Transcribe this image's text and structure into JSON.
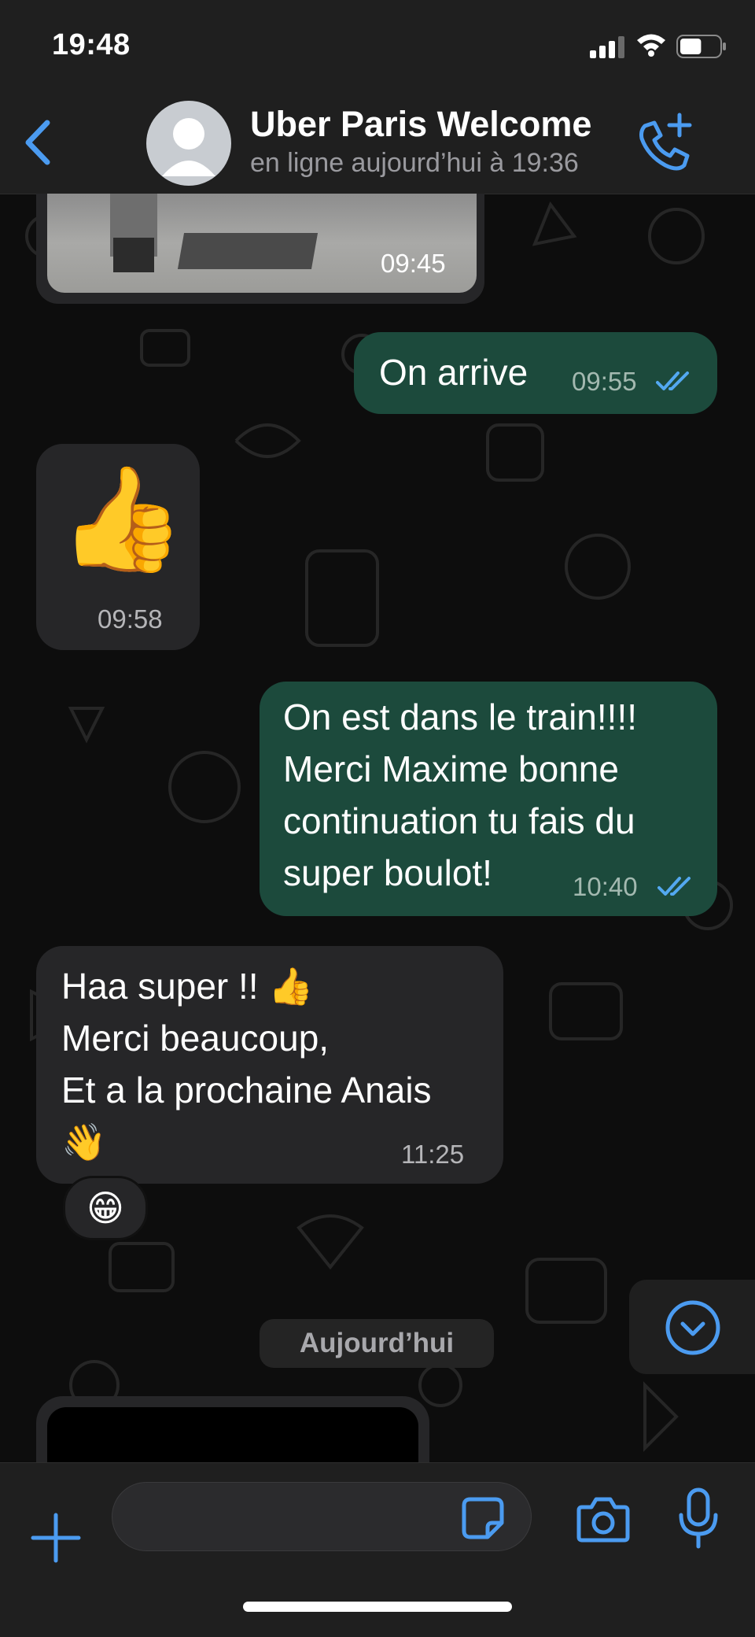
{
  "status_bar": {
    "time": "19:48",
    "battery_level": 0.55
  },
  "header": {
    "contact_name": "Uber Paris Welcome",
    "contact_status": "en ligne aujourd’hui à 19:36"
  },
  "messages": [
    {
      "type": "image",
      "direction": "in",
      "time": "09:45"
    },
    {
      "type": "text",
      "direction": "out",
      "lines": [
        "On arrive"
      ],
      "time": "09:55",
      "read": true
    },
    {
      "type": "emoji",
      "direction": "in",
      "emoji": "👍",
      "time": "09:58"
    },
    {
      "type": "text",
      "direction": "out",
      "lines": [
        "On est dans le train!!!!",
        "Merci Maxime bonne",
        "continuation tu fais du",
        "super boulot!"
      ],
      "time": "10:40",
      "read": true
    },
    {
      "type": "text",
      "direction": "in",
      "lines": [
        "Haa super !! 👍",
        "Merci beaucoup,",
        "Et a la prochaine Anais",
        "👋"
      ],
      "time": "11:25",
      "reaction": "😁"
    }
  ],
  "date_separator": "Aujourd’hui",
  "composer": {
    "value": "",
    "placeholder": ""
  },
  "colors": {
    "accent": "#4b9bf0",
    "outgoing_bubble": "#1c4a3c",
    "incoming_bubble": "#262628",
    "read_receipt": "#53a8f0"
  },
  "icons": [
    "back-chevron-icon",
    "avatar-placeholder-icon",
    "add-call-icon",
    "double-check-icon",
    "scroll-down-chevron-icon",
    "plus-icon",
    "sticker-icon",
    "camera-icon",
    "microphone-icon"
  ]
}
